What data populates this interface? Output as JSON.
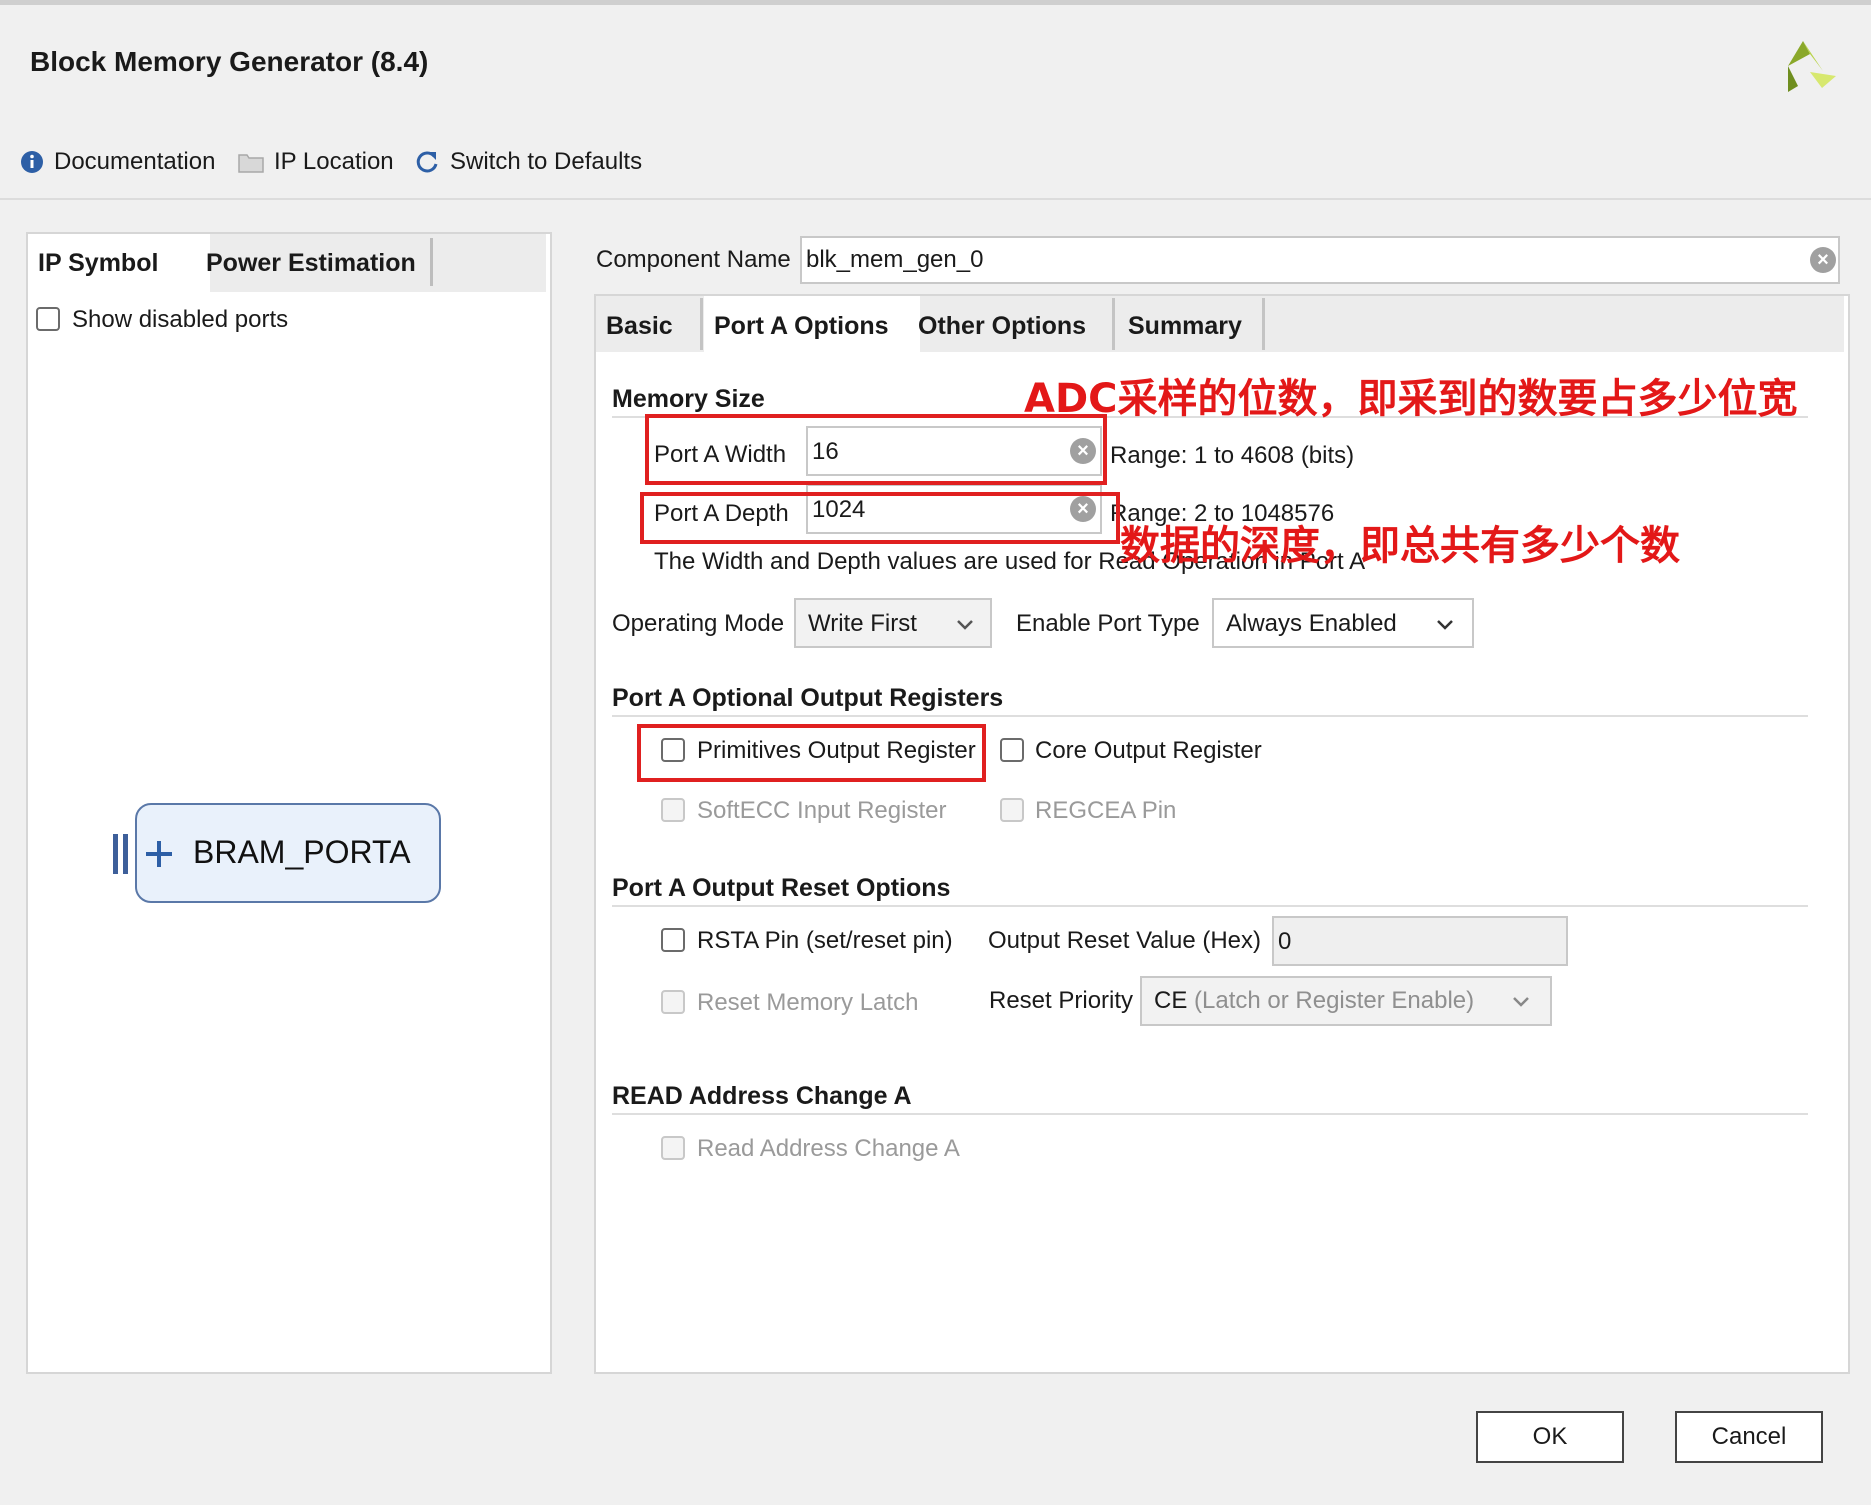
{
  "window": {
    "title": "Block Memory Generator (8.4)"
  },
  "toolbar": {
    "documentation": "Documentation",
    "ip_location": "IP Location",
    "switch_defaults": "Switch to Defaults"
  },
  "left_panel": {
    "tabs": [
      "IP Symbol",
      "Power Estimation"
    ],
    "show_disabled_ports": "Show disabled ports",
    "bram_port": "BRAM_PORTA"
  },
  "component": {
    "label": "Component Name",
    "value": "blk_mem_gen_0"
  },
  "right_tabs": [
    "Basic",
    "Port A Options",
    "Other Options",
    "Summary"
  ],
  "memory_size": {
    "title": "Memory Size",
    "width_label": "Port A Width",
    "width_value": "16",
    "width_range": "Range: 1 to 4608 (bits)",
    "depth_label": "Port A Depth",
    "depth_value": "1024",
    "depth_range": "Range: 2 to 1048576",
    "note": "The Width and Depth values are used for Read Operation in Port A"
  },
  "modes": {
    "operating_label": "Operating Mode",
    "operating_value": "Write First",
    "enable_label": "Enable Port Type",
    "enable_value": "Always Enabled"
  },
  "optional_regs": {
    "title": "Port A Optional Output Registers",
    "primitives": "Primitives Output Register",
    "core": "Core Output Register",
    "softecc": "SoftECC Input Register",
    "regcea": "REGCEA Pin"
  },
  "reset_opts": {
    "title": "Port A Output Reset Options",
    "rsta": "RSTA Pin (set/reset pin)",
    "reset_value_label": "Output Reset Value (Hex)",
    "reset_value": "0",
    "reset_latch": "Reset Memory Latch",
    "priority_label": "Reset Priority",
    "priority_value_main": "CE",
    "priority_value_rest": " (Latch or Register Enable)"
  },
  "read_addr": {
    "title": "READ Address Change A",
    "checkbox": "Read Address Change A"
  },
  "annotations": {
    "width_note": "ADC采样的位数，即采到的数要占多少位宽",
    "depth_note": "数据的深度，即总共有多少个数"
  },
  "buttons": {
    "ok": "OK",
    "cancel": "Cancel"
  },
  "colors": {
    "annotation": "#e31818",
    "accent": "#2d5fa6"
  }
}
